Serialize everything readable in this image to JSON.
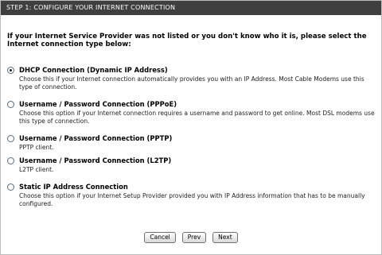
{
  "header": {
    "title": "STEP 1: CONFIGURE YOUR INTERNET CONNECTION"
  },
  "intro": "If your Internet Service Provider was not listed or you don't know who it is, please select the Internet connection type below:",
  "options": [
    {
      "title": "DHCP Connection (Dynamic IP Address)",
      "desc": "Choose this if your Internet connection automatically provides you with an IP Address. Most Cable Modems use this type of connection.",
      "checked": true
    },
    {
      "title": "Username / Password Connection (PPPoE)",
      "desc": "Choose this option if your Internet connection requires a username and password to get online. Most DSL modems use this type of connection.",
      "checked": false
    },
    {
      "title": "Username / Password Connection (PPTP)",
      "desc": "PPTP client.",
      "checked": false
    },
    {
      "title": "Username / Password Connection (L2TP)",
      "desc": "L2TP client.",
      "checked": false
    },
    {
      "title": "Static IP Address Connection",
      "desc": "Choose this option if your Internet Setup Provider provided you with IP Address information that has to be manually configured.",
      "checked": false
    }
  ],
  "buttons": {
    "cancel": "Cancel",
    "prev": "Prev",
    "next": "Next"
  },
  "colors": {
    "header_bg": "#3f3f3f",
    "header_text": "#ffffff"
  }
}
